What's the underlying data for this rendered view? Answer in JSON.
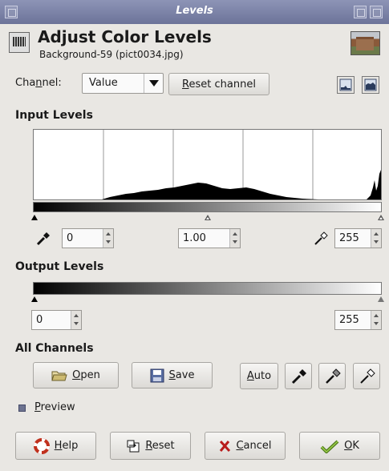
{
  "window": {
    "title": "Levels"
  },
  "header": {
    "title": "Adjust Color Levels",
    "subtitle": "Background-59 (pict0034.jpg)"
  },
  "channel": {
    "label_pre": "Cha",
    "label_mn": "n",
    "label_post": "nel:",
    "value": "Value",
    "reset_pre": "R",
    "reset_post": "eset channel"
  },
  "input_levels": {
    "title": "Input Levels",
    "low": "0",
    "gamma": "1.00",
    "high": "255"
  },
  "output_levels": {
    "title": "Output Levels",
    "low": "0",
    "high": "255"
  },
  "all_channels": {
    "title": "All Channels",
    "open_mn": "O",
    "open_rest": "pen",
    "save_mn": "S",
    "save_rest": "ave",
    "auto_mn": "A",
    "auto_rest": "uto"
  },
  "preview": {
    "mn": "P",
    "rest": "review",
    "checked": true
  },
  "footer": {
    "help_mn": "H",
    "help_rest": "elp",
    "reset_mn": "R",
    "reset_rest": "eset",
    "cancel_mn": "C",
    "cancel_rest": "ancel",
    "ok_mn": "O",
    "ok_rest": "K"
  },
  "colors": {
    "titlebar": "#7a80a6",
    "background": "#e9e7e3"
  }
}
